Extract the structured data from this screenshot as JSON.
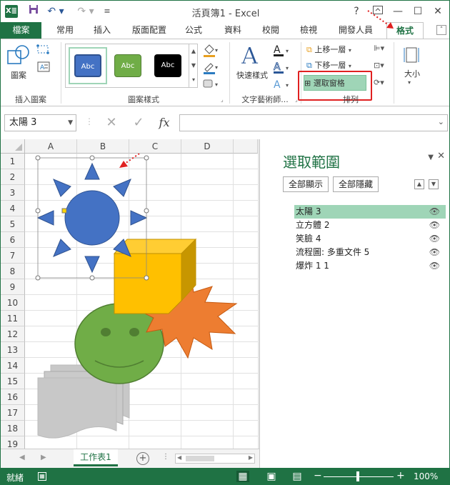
{
  "window": {
    "app_icon": "X≣",
    "title": "活頁簿1 - Excel",
    "help": "?",
    "minimize": "—",
    "maximize": "☐",
    "close": "✕"
  },
  "tabs": {
    "file": "檔案",
    "items": [
      "常用",
      "插入",
      "版面配置",
      "公式",
      "資料",
      "校閱",
      "檢視",
      "開發人員"
    ],
    "contextual": "格式"
  },
  "ribbon": {
    "insert_shapes": {
      "shapes_label": "圖案",
      "group_label": "插入圖案"
    },
    "shape_styles": {
      "swatch_text": "Abc",
      "group_label": "圖案樣式",
      "colors": [
        "#4472c4",
        "#70ad47",
        "#000000"
      ]
    },
    "wordart": {
      "quick_styles": "快速樣式",
      "group_label": "文字藝術師..."
    },
    "arrange": {
      "bring_forward": "上移一層",
      "send_backward": "下移一層",
      "selection_pane": "選取窗格",
      "group_label": "排列"
    },
    "size": {
      "label": "大小"
    }
  },
  "formula_bar": {
    "name_box": "太陽 3",
    "cancel": "✕",
    "enter": "✓",
    "fx": "fx",
    "formula": ""
  },
  "grid": {
    "columns": [
      "A",
      "B",
      "C",
      "D"
    ],
    "rows": [
      "1",
      "2",
      "3",
      "4",
      "5",
      "6",
      "7",
      "8",
      "9",
      "10",
      "11",
      "12",
      "13",
      "14",
      "15",
      "16",
      "17",
      "18",
      "19"
    ]
  },
  "selection_pane": {
    "title": "選取範圍",
    "show_all": "全部顯示",
    "hide_all": "全部隱藏",
    "objects": [
      "太陽 3",
      "立方體 2",
      "笑臉 4",
      "流程圖: 多重文件 5",
      "爆炸 1 1"
    ]
  },
  "sheet_tabs": {
    "sheet": "工作表1"
  },
  "status": {
    "ready": "就緒",
    "zoom": "100%"
  },
  "colors": {
    "accent": "#1f7244",
    "highlight": "#9fd5b7",
    "callout": "#e02020"
  }
}
